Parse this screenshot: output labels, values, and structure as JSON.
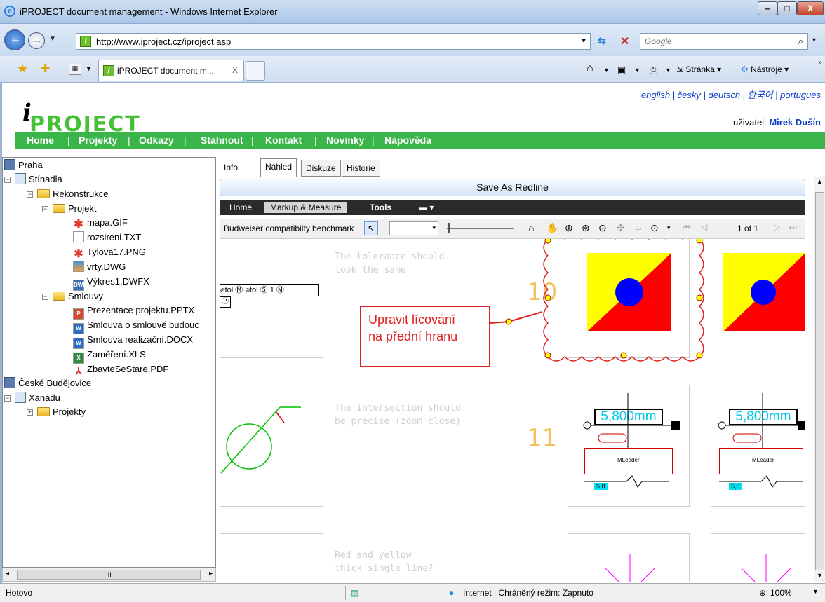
{
  "window": {
    "title": "iPROJECT document management - Windows Internet Explorer",
    "minimize": "–",
    "maximize": "□",
    "close": "X"
  },
  "addressbar": {
    "url": "http://www.iproject.cz/iproject.asp",
    "search_placeholder": "Google"
  },
  "tabbar": {
    "tab_title": "iPROJECT document m...",
    "tab_close": "X",
    "tools": [
      "Stránka ▾",
      "Nástroje ▾"
    ]
  },
  "site": {
    "logo_text": "PROJECT",
    "languages": [
      "english",
      "česky",
      "deutsch",
      "한국어",
      "portugues"
    ],
    "user_label": "uživatel:",
    "user_name": "Mirek Dušín",
    "nav": [
      "Home",
      "Projekty",
      "Odkazy",
      "Stáhnout",
      "Kontakt",
      "Novinky",
      "Nápověda"
    ]
  },
  "tree": {
    "nodes": [
      {
        "label": "Praha",
        "icon": "building-icon"
      },
      {
        "label": "Stínadla",
        "icon": "project-icon"
      },
      {
        "label": "Rekonstrukce",
        "icon": "folder-icon"
      },
      {
        "label": "Projekt",
        "icon": "folder-icon"
      },
      {
        "label": "mapa.GIF",
        "icon": "image-icon"
      },
      {
        "label": "rozsireni.TXT",
        "icon": "text-file-icon"
      },
      {
        "label": "Tylova17.PNG",
        "icon": "image-icon"
      },
      {
        "label": "vrty.DWG",
        "icon": "dwg-icon"
      },
      {
        "label": "Výkres1.DWFX",
        "icon": "dwf-icon"
      },
      {
        "label": "Smlouvy",
        "icon": "folder-icon"
      },
      {
        "label": "Prezentace projektu.PPTX",
        "icon": "pptx-icon"
      },
      {
        "label": "Smlouva o smlouvě budouc",
        "icon": "docx-icon"
      },
      {
        "label": "Smlouva realizační.DOCX",
        "icon": "docx-icon"
      },
      {
        "label": "Zaměření.XLS",
        "icon": "xls-icon"
      },
      {
        "label": "ZbavteSeStare.PDF",
        "icon": "pdf-icon"
      },
      {
        "label": "České Budějovice",
        "icon": "building-icon"
      },
      {
        "label": "Xanadu",
        "icon": "project-icon"
      },
      {
        "label": "Projekty",
        "icon": "folder-icon"
      }
    ],
    "scroll_thumb": "III"
  },
  "doc_tabs": [
    "Info",
    "Náhled",
    "Diskuze",
    "Historie"
  ],
  "viewer": {
    "save_redline": "Save As Redline",
    "menu": [
      "Home",
      "Markup & Measure",
      "Tools"
    ],
    "doc_name": "Budweiser compatibilty benchmark",
    "page_info": "1 of 1",
    "notes": [
      [
        "The tolerance should",
        "look the same"
      ],
      [
        "The intersection should",
        "be precise (zoom close)"
      ],
      [
        "Red and yellow",
        "thick single line?"
      ]
    ],
    "numbers": [
      "10",
      "11"
    ],
    "markup_text": [
      "Upravit lícování",
      "na přední hranu"
    ],
    "tolerance_text": "⌀tol Ⓜ ⌀tol Ⓢ 1 Ⓜ",
    "dimension": "5,800mm",
    "mleader": "MLeader",
    "small_dim": "5,8"
  },
  "status": {
    "left": "Hotovo",
    "zone": "Internet | Chráněný režim: Zapnuto",
    "zoom": "100%"
  }
}
